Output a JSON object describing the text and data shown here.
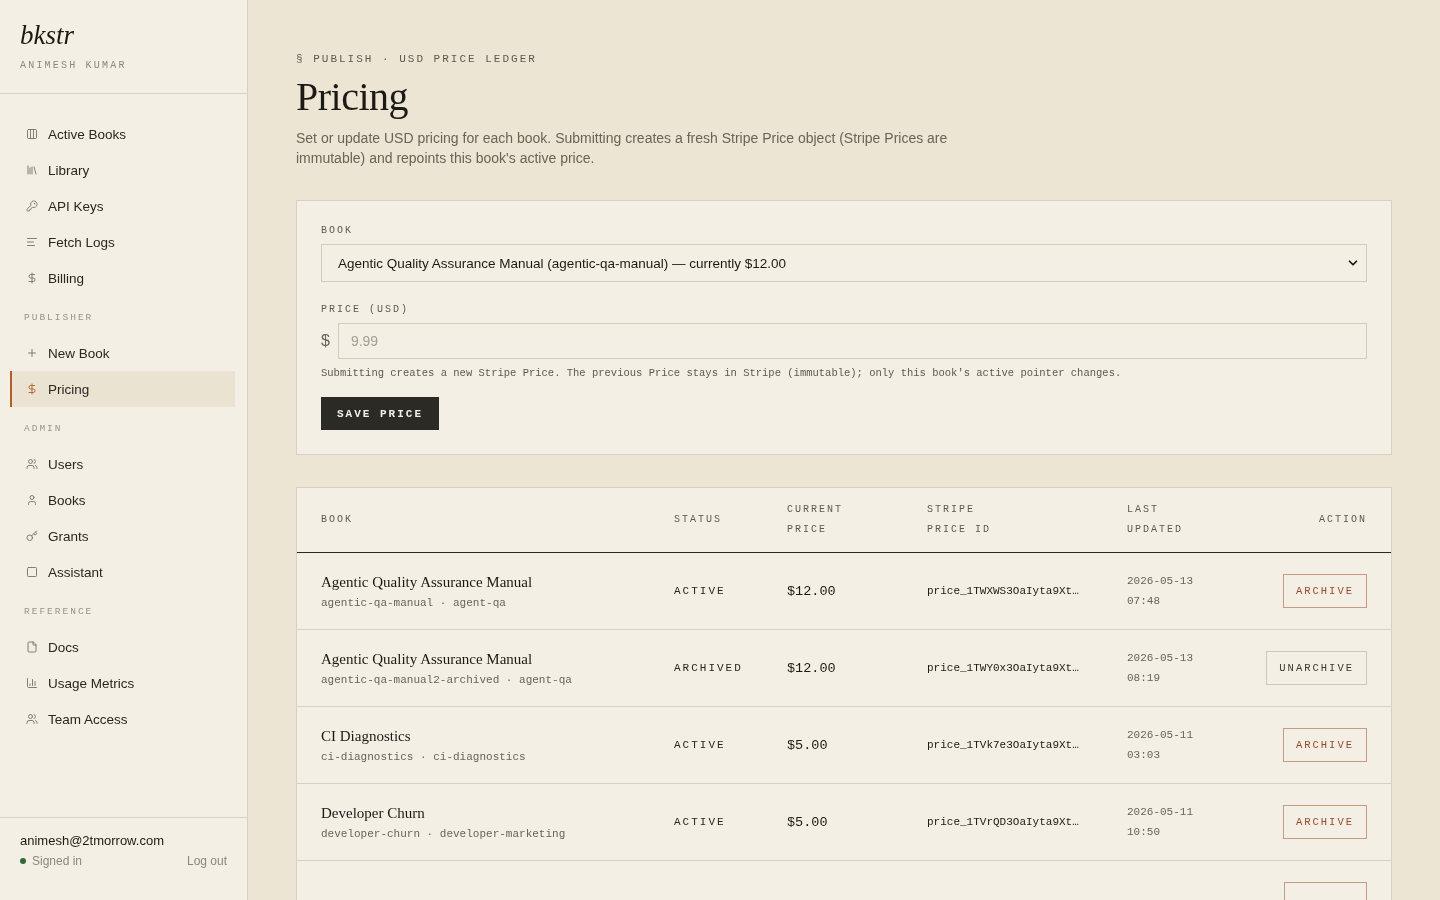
{
  "brand": {
    "logo": "bkstr",
    "user": "ANIMESH KUMAR"
  },
  "nav": [
    {
      "items": [
        {
          "label": "Active Books",
          "selected": false
        },
        {
          "label": "Library",
          "selected": false
        },
        {
          "label": "API Keys",
          "selected": false
        },
        {
          "label": "Fetch Logs",
          "selected": false
        },
        {
          "label": "Billing",
          "selected": false
        }
      ]
    },
    {
      "heading": "PUBLISHER",
      "items": [
        {
          "label": "New Book",
          "selected": false
        },
        {
          "label": "Pricing",
          "selected": true
        }
      ]
    },
    {
      "heading": "ADMIN",
      "items": [
        {
          "label": "Users",
          "selected": false
        },
        {
          "label": "Books",
          "selected": false
        },
        {
          "label": "Grants",
          "selected": false
        },
        {
          "label": "Assistant",
          "selected": false
        }
      ]
    },
    {
      "heading": "REFERENCE",
      "items": [
        {
          "label": "Docs",
          "selected": false
        },
        {
          "label": "Usage Metrics",
          "selected": false
        },
        {
          "label": "Team Access",
          "selected": false
        }
      ]
    }
  ],
  "account": {
    "email": "animesh@2tmorrow.com",
    "status": "Signed in",
    "signed_in": true,
    "logout": "Log out"
  },
  "page": {
    "eyebrow": "§ PUBLISH · USD PRICE LEDGER",
    "title": "Pricing",
    "description": "Set or update USD pricing for each book. Submitting creates a fresh Stripe Price object (Stripe Prices are immutable) and repoints this book's active price."
  },
  "form": {
    "book_label": "BOOK",
    "book_value": "Agentic Quality Assurance Manual (agentic-qa-manual) — currently $12.00",
    "price_label": "PRICE (USD)",
    "currency": "$",
    "price_placeholder": "9.99",
    "hint": "Submitting creates a new Stripe Price. The previous Price stays in Stripe (immutable); only this book's active pointer changes.",
    "submit": "SAVE PRICE"
  },
  "table": {
    "columns": [
      "BOOK",
      "STATUS",
      "CURRENT PRICE",
      "STRIPE PRICE ID",
      "LAST UPDATED",
      "ACTION"
    ],
    "rows": [
      {
        "title": "Agentic Quality Assurance Manual",
        "slug": "agentic-qa-manual · agent-qa",
        "status": "ACTIVE",
        "price": "$12.00",
        "stripe_id": "price_1TWXWS3OaIyta9Xt…",
        "updated": [
          "2026-05-13",
          "07:48"
        ],
        "action": {
          "kind": "archive",
          "label": "ARCHIVE"
        }
      },
      {
        "title": "Agentic Quality Assurance Manual",
        "slug": "agentic-qa-manual2-archived · agent-qa",
        "status": "ARCHIVED",
        "price": "$12.00",
        "stripe_id": "price_1TWY0x3OaIyta9Xt…",
        "updated": [
          "2026-05-13",
          "08:19"
        ],
        "action": {
          "kind": "unarchive",
          "label": "UNARCHIVE"
        }
      },
      {
        "title": "CI Diagnostics",
        "slug": "ci-diagnostics · ci-diagnostics",
        "status": "ACTIVE",
        "price": "$5.00",
        "stripe_id": "price_1TVk7e3OaIyta9Xt…",
        "updated": [
          "2026-05-11",
          "03:03"
        ],
        "action": {
          "kind": "archive",
          "label": "ARCHIVE"
        }
      },
      {
        "title": "Developer Churn",
        "slug": "developer-churn · developer-marketing",
        "status": "ACTIVE",
        "price": "$5.00",
        "stripe_id": "price_1TVrQD3OaIyta9Xt…",
        "updated": [
          "2026-05-11",
          "10:50"
        ],
        "action": {
          "kind": "archive",
          "label": "ARCHIVE"
        }
      },
      {
        "action": {
          "kind": "archive"
        }
      }
    ]
  }
}
